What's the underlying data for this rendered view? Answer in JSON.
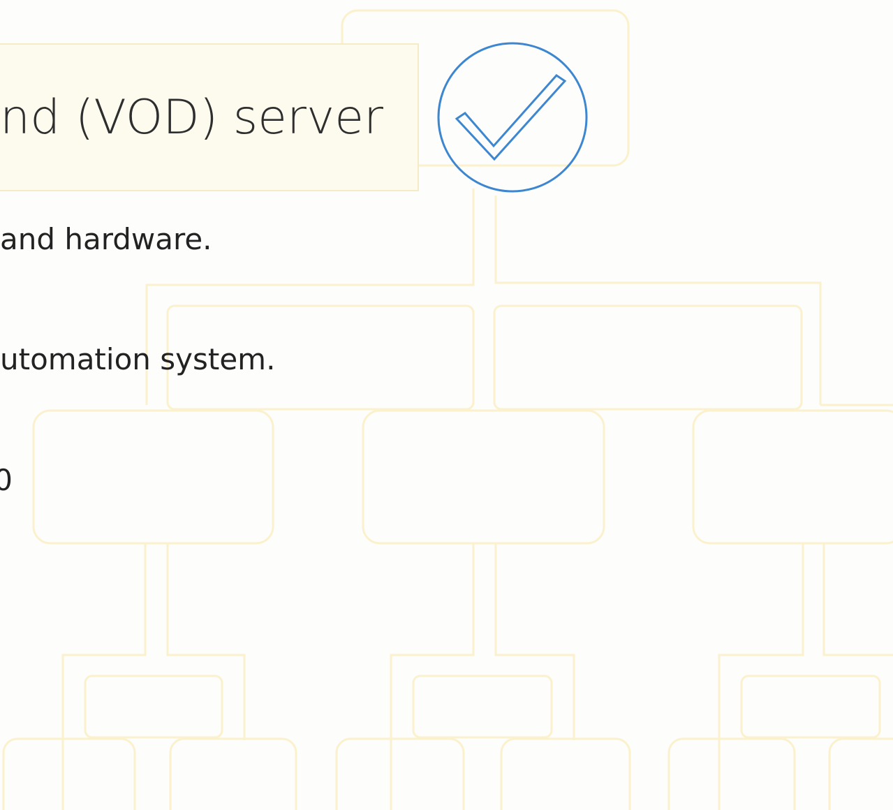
{
  "document": {
    "title": "nd (VOD) server",
    "lines": [
      "and hardware.",
      "utomation system.",
      "0"
    ]
  },
  "icons": {
    "check": "check-circle-icon"
  },
  "colors": {
    "check_stroke": "#3d86d0",
    "title_fill": "#fdfaee",
    "tree_stroke": "#fbf1cd"
  }
}
